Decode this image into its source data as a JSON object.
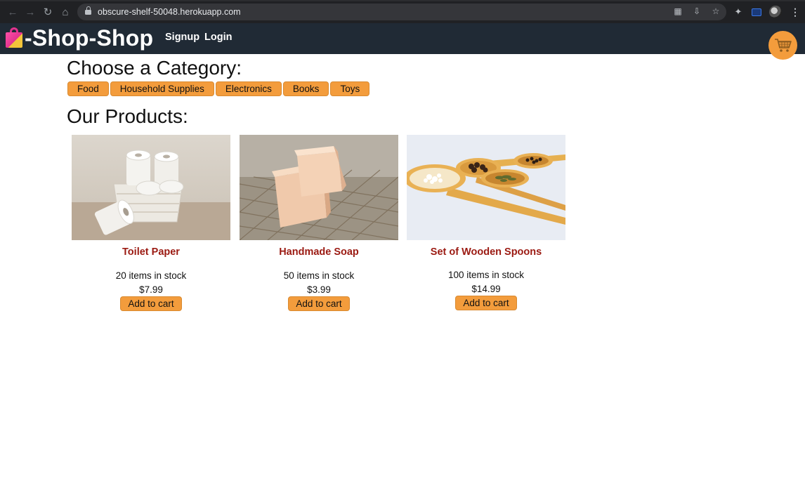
{
  "browser": {
    "url": "obscure-shelf-50048.herokuapp.com"
  },
  "header": {
    "logo_text": "-Shop-Shop",
    "nav": [
      {
        "label": "Signup"
      },
      {
        "label": "Login"
      }
    ],
    "cart_icon": "shopping-cart-icon",
    "accent_color": "#f39c3c",
    "background_color": "#202a35"
  },
  "categories": {
    "title": "Choose a Category:",
    "items": [
      "Food",
      "Household Supplies",
      "Electronics",
      "Books",
      "Toys"
    ]
  },
  "products": {
    "title": "Our Products:",
    "add_label": "Add to cart",
    "items": [
      {
        "name": "Toilet Paper",
        "stock": "20 items in stock",
        "price": "$7.99",
        "image": "toilet-paper-image"
      },
      {
        "name": "Handmade Soap",
        "stock": "50 items in stock",
        "price": "$3.99",
        "image": "soap-image"
      },
      {
        "name": "Set of Wooden Spoons",
        "stock": "100 items in stock",
        "price": "$14.99",
        "image": "wooden-spoons-image"
      }
    ]
  }
}
